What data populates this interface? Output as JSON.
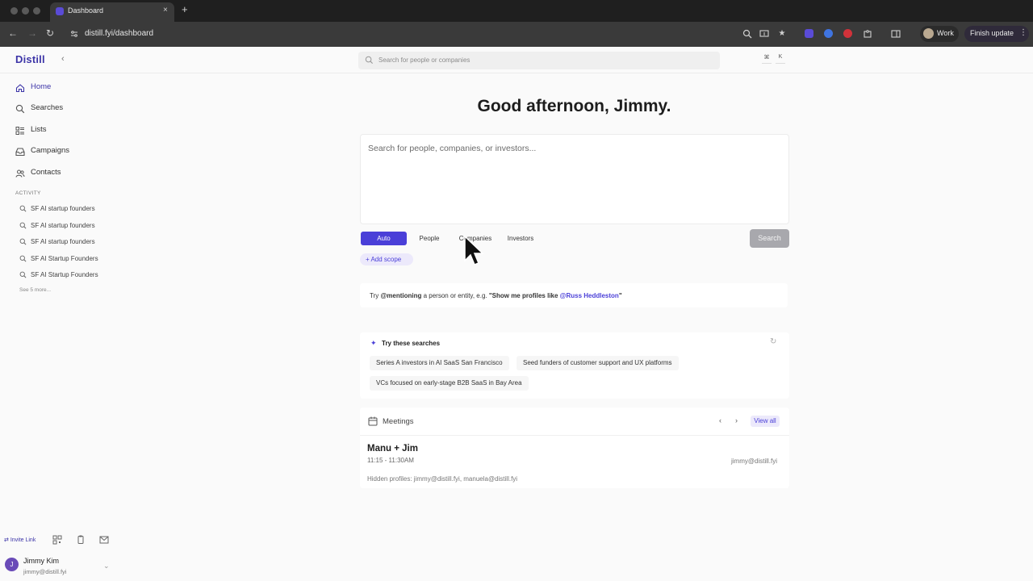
{
  "browser": {
    "tab_title": "Dashboard",
    "url": "distill.fyi/dashboard",
    "profile_label": "Work",
    "update_label": "Finish update",
    "new_tab_glyph": "+",
    "close_glyph": "×"
  },
  "app": {
    "logo": "Distill",
    "collapse_glyph": "‹",
    "search_placeholder": "Search for people or companies",
    "shortcut_keys": [
      "⌘",
      "K"
    ]
  },
  "sidebar": {
    "nav": [
      {
        "label": "Home",
        "icon": "home-icon",
        "active": true
      },
      {
        "label": "Searches",
        "icon": "search-icon"
      },
      {
        "label": "Lists",
        "icon": "list-icon"
      },
      {
        "label": "Campaigns",
        "icon": "inbox-icon"
      },
      {
        "label": "Contacts",
        "icon": "contacts-icon"
      }
    ],
    "activity_label": "ACTIVITY",
    "activity": [
      "SF AI startup founders",
      "SF AI startup founders",
      "SF AI startup founders",
      "SF AI Startup Founders",
      "SF AI Startup Founders"
    ],
    "see_more": "See 5 more...",
    "invite_link": "Invite Link",
    "user": {
      "initial": "J",
      "name": "Jimmy Kim",
      "email": "jimmy@distill.fyi"
    }
  },
  "main": {
    "greeting": "Good afternoon, Jimmy.",
    "composer_placeholder": "Search for people, companies, or investors...",
    "modes": [
      "Auto",
      "People",
      "Companies",
      "Investors"
    ],
    "active_mode": "Auto",
    "search_button": "Search",
    "add_scope": "+ Add scope",
    "hint": {
      "prefix": "Try ",
      "mention_word": "@mentioning",
      "middle": " a person or entity, e.g. ",
      "example_start": "\"Show me profiles like ",
      "example_mention": "@Russ Heddleston",
      "example_end": "\""
    },
    "suggestions": {
      "title": "Try these searches",
      "items": [
        "Series A investors in AI SaaS San Francisco",
        "Seed funders of customer support and UX platforms",
        "VCs focused on early-stage B2B SaaS in Bay Area"
      ]
    },
    "meetings": {
      "title": "Meetings",
      "view_all": "View all",
      "prev_glyph": "‹",
      "next_glyph": "›",
      "item": {
        "name": "Manu + Jim",
        "time": "11:15 - 11:30AM",
        "owner": "jimmy@distill.fyi",
        "hidden": "Hidden profiles: jimmy@distill.fyi, manuela@distill.fyi"
      }
    }
  },
  "colors": {
    "accent": "#4a3fd8",
    "logo": "#3d35a8"
  }
}
